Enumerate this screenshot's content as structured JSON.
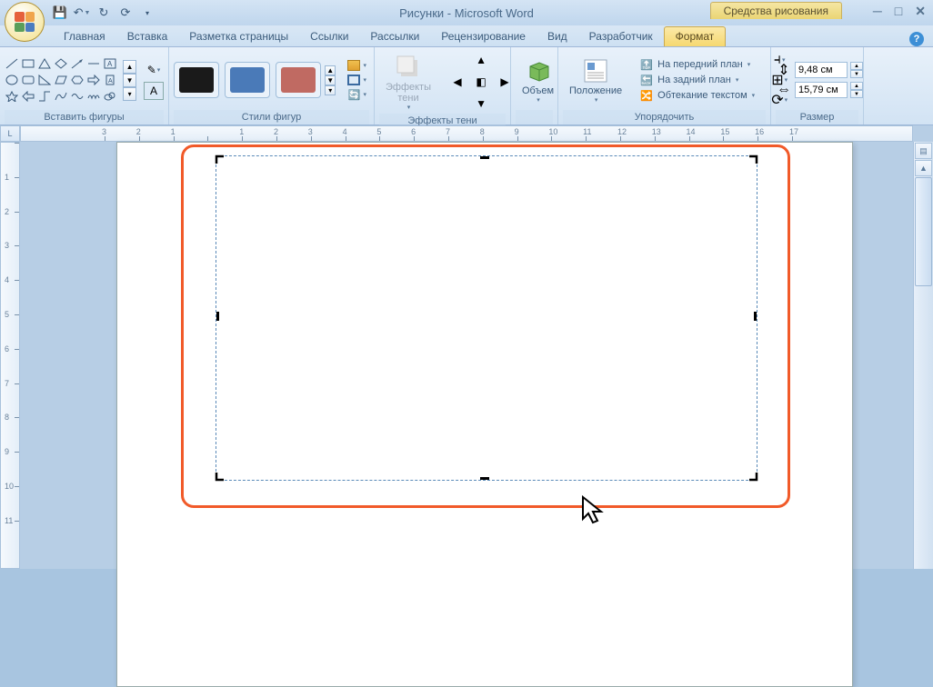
{
  "title": "Рисунки - Microsoft Word",
  "context_tab": "Средства рисования",
  "tabs": [
    "Главная",
    "Вставка",
    "Разметка страницы",
    "Ссылки",
    "Рассылки",
    "Рецензирование",
    "Вид",
    "Разработчик",
    "Формат"
  ],
  "active_tab": 8,
  "groups": {
    "insert_shapes": "Вставить фигуры",
    "shape_styles": "Стили фигур",
    "shadow_effects_btn": "Эффекты тени",
    "shadow_effects": "Эффекты тени",
    "threed": "Объем",
    "position": "Положение",
    "arrange": "Упорядочить",
    "size": "Размер"
  },
  "arrange_items": [
    "На передний план",
    "На задний план",
    "Обтекание текстом"
  ],
  "style_colors": [
    "#1a1a1a",
    "#3f6fa8",
    "#b85a52"
  ],
  "size_values": {
    "height": "9,48 см",
    "width": "15,79 см"
  },
  "ruler_h": [
    "3",
    "2",
    "1",
    "",
    "1",
    "2",
    "3",
    "4",
    "5",
    "6",
    "7",
    "8",
    "9",
    "10",
    "11",
    "12",
    "13",
    "14",
    "15",
    "16",
    "17"
  ],
  "ruler_v": [
    "",
    "1",
    "2",
    "3",
    "4",
    "5",
    "6",
    "7",
    "8",
    "9",
    "10",
    "11"
  ]
}
